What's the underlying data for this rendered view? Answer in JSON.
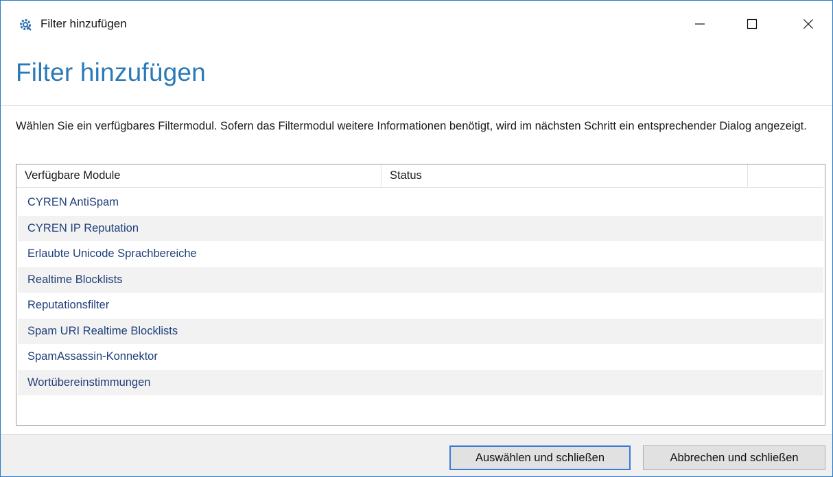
{
  "window": {
    "title": "Filter hinzufügen",
    "icon": "settings-gear-icon",
    "controls": {
      "minimize": "minimize-icon",
      "maximize": "maximize-icon",
      "close": "close-icon"
    }
  },
  "header": {
    "title": "Filter hinzufügen"
  },
  "description": "Wählen Sie ein verfügbares Filtermodul. Sofern das Filtermodul weitere Informationen benötigt, wird im nächsten Schritt ein entsprechender Dialog angezeigt.",
  "list": {
    "columns": [
      "Verfügbare Module",
      "Status",
      ""
    ],
    "rows": [
      {
        "module": "CYREN AntiSpam",
        "status": ""
      },
      {
        "module": "CYREN IP Reputation",
        "status": ""
      },
      {
        "module": "Erlaubte Unicode Sprachbereiche",
        "status": ""
      },
      {
        "module": "Realtime Blocklists",
        "status": ""
      },
      {
        "module": "Reputationsfilter",
        "status": ""
      },
      {
        "module": "Spam URI Realtime Blocklists",
        "status": ""
      },
      {
        "module": "SpamAssassin-Konnektor",
        "status": ""
      },
      {
        "module": "Wortübereinstimmungen",
        "status": ""
      }
    ]
  },
  "footer": {
    "select_label": "Auswählen und schließen",
    "cancel_label": "Abbrechen und schließen"
  },
  "colors": {
    "accent": "#2a7ab9",
    "row_text": "#1f3f7a",
    "alt_row": "#f2f2f2",
    "footer_bg": "#f0f0f0"
  }
}
